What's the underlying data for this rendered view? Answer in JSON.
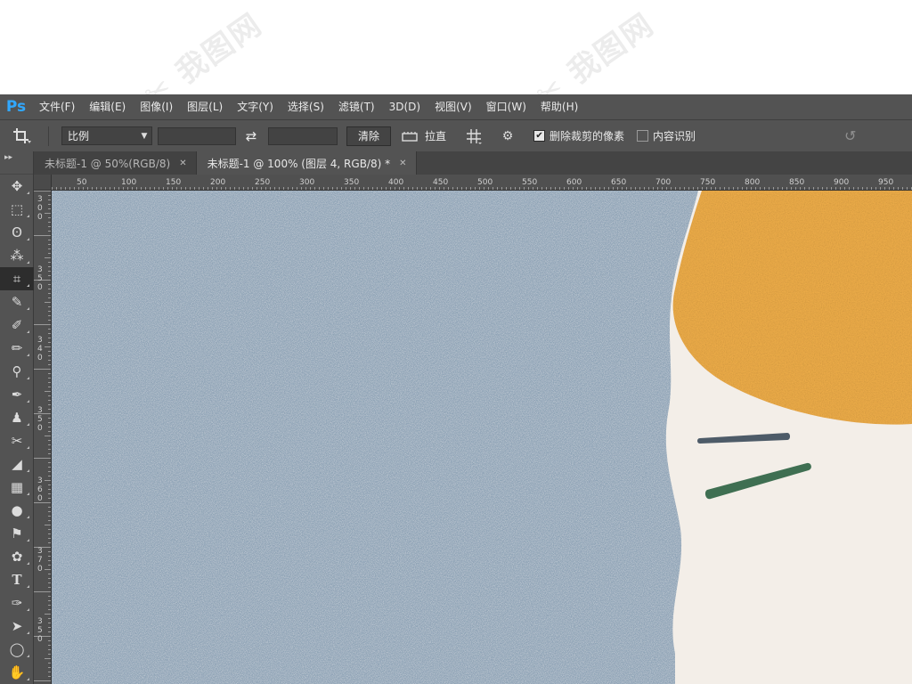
{
  "app": {
    "logo": "Ps",
    "menu": [
      "文件(F)",
      "编辑(E)",
      "图像(I)",
      "图层(L)",
      "文字(Y)",
      "选择(S)",
      "滤镜(T)",
      "3D(D)",
      "视图(V)",
      "窗口(W)",
      "帮助(H)"
    ]
  },
  "options": {
    "ratio_select": "比例",
    "clear_button": "清除",
    "straighten_label": "拉直",
    "delete_cropped_label": "删除裁剪的像素",
    "delete_cropped_checked": true,
    "content_aware_label": "内容识别",
    "content_aware_checked": false
  },
  "tabs": [
    {
      "title": "未标题-1 @ 50%(RGB/8)",
      "active": false
    },
    {
      "title": "未标题-1 @ 100% (图层 4, RGB/8) *",
      "active": true
    }
  ],
  "ruler": {
    "h_labels": [
      "50",
      "100",
      "150",
      "200",
      "250",
      "300",
      "350",
      "400",
      "450",
      "500",
      "550",
      "600",
      "650",
      "700",
      "750",
      "800",
      "850",
      "900",
      "950"
    ],
    "v_labels": [
      "3 0 0",
      "3 5 0",
      "3 4 0",
      "3 5 0",
      "3 6 0",
      "3 7 0",
      "3 5 0"
    ]
  },
  "tools": [
    {
      "name": "move-tool",
      "glyph": "✥",
      "active": false
    },
    {
      "name": "marquee-tool",
      "glyph": "⬚",
      "active": false
    },
    {
      "name": "lasso-tool",
      "glyph": "ʘ",
      "active": false
    },
    {
      "name": "magic-wand-tool",
      "glyph": "⁂",
      "active": false
    },
    {
      "name": "crop-tool",
      "glyph": "⌗",
      "active": true
    },
    {
      "name": "eyedropper-tool",
      "glyph": "✎",
      "active": false
    },
    {
      "name": "healing-brush-tool",
      "glyph": "✐",
      "active": false
    },
    {
      "name": "brush-tool",
      "glyph": "✏",
      "active": false
    },
    {
      "name": "clone-stamp-tool",
      "glyph": "⚲",
      "active": false
    },
    {
      "name": "history-brush-tool",
      "glyph": "✒",
      "active": false
    },
    {
      "name": "stamp-tool",
      "glyph": "♟",
      "active": false
    },
    {
      "name": "art-history-brush-tool",
      "glyph": "✂",
      "active": false
    },
    {
      "name": "eraser-tool",
      "glyph": "◢",
      "active": false
    },
    {
      "name": "gradient-tool",
      "glyph": "▦",
      "active": false
    },
    {
      "name": "blur-tool",
      "glyph": "●",
      "active": false
    },
    {
      "name": "dodge-tool",
      "glyph": "⚑",
      "active": false
    },
    {
      "name": "sponge-tool",
      "glyph": "✿",
      "active": false
    },
    {
      "name": "type-tool",
      "glyph": "T",
      "active": false
    },
    {
      "name": "pen-tool",
      "glyph": "✑",
      "active": false
    },
    {
      "name": "path-selection-tool",
      "glyph": "➤",
      "active": false
    },
    {
      "name": "ellipse-tool",
      "glyph": "◯",
      "active": false
    },
    {
      "name": "hand-tool",
      "glyph": "✋",
      "active": false
    }
  ],
  "colors": {
    "chrome": "#535353",
    "panel_dark": "#444444",
    "canvas_blue": "#8fa3b5",
    "canvas_orange": "#f2b04a",
    "canvas_cream": "#f3eee8",
    "stroke_dark": "#4d5b68",
    "stroke_green": "#3f6f52"
  }
}
